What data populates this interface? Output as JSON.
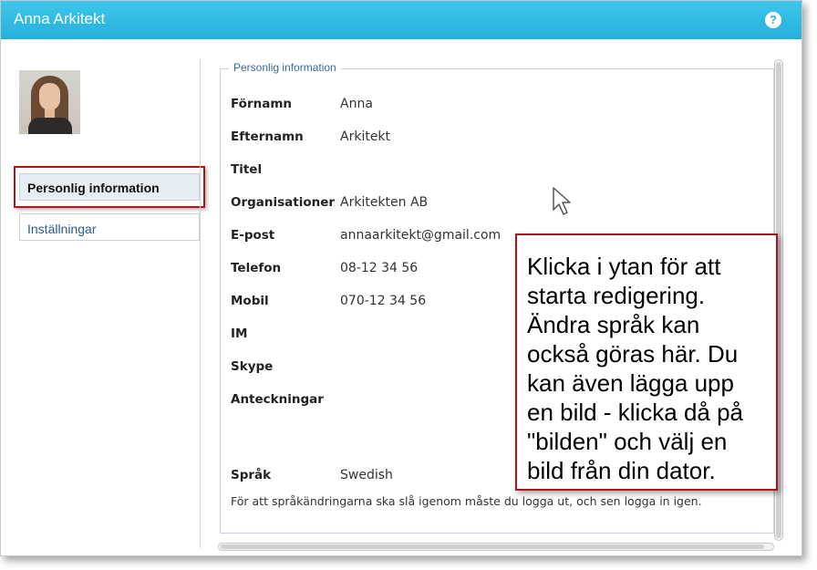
{
  "window": {
    "title": "Anna Arkitekt",
    "help_icon": "?"
  },
  "sidebar": {
    "avatar": "avatar",
    "items": [
      {
        "label": "Personlig information",
        "active": true
      },
      {
        "label": "Inställningar",
        "active": false
      }
    ]
  },
  "main": {
    "legend": "Personlig information",
    "fields": [
      {
        "label": "Förnamn",
        "value": "Anna"
      },
      {
        "label": "Efternamn",
        "value": "Arkitekt"
      },
      {
        "label": "Titel",
        "value": ""
      },
      {
        "label": "Organisationer",
        "value": "Arkitekten AB"
      },
      {
        "label": "E-post",
        "value": "annaarkitekt@gmail.com"
      },
      {
        "label": "Telefon",
        "value": "08-12 34 56"
      },
      {
        "label": "Mobil",
        "value": "070-12 34 56"
      },
      {
        "label": "IM",
        "value": ""
      },
      {
        "label": "Skype",
        "value": ""
      },
      {
        "label": "Anteckningar",
        "value": ""
      },
      {
        "label": "Språk",
        "value": "Swedish"
      }
    ],
    "note": "För att språkändringarna ska slå igenom måste du logga ut, och sen logga in igen."
  },
  "callout": {
    "text": "Klicka i ytan för att starta redigering. Ändra språk kan också göras här. Du kan även lägga upp en bild - klicka då på \"bilden\" och välj en bild från din dator."
  },
  "colors": {
    "titlebar": "#29b3de",
    "highlight": "#b3121a",
    "link": "#2a5a8a"
  }
}
